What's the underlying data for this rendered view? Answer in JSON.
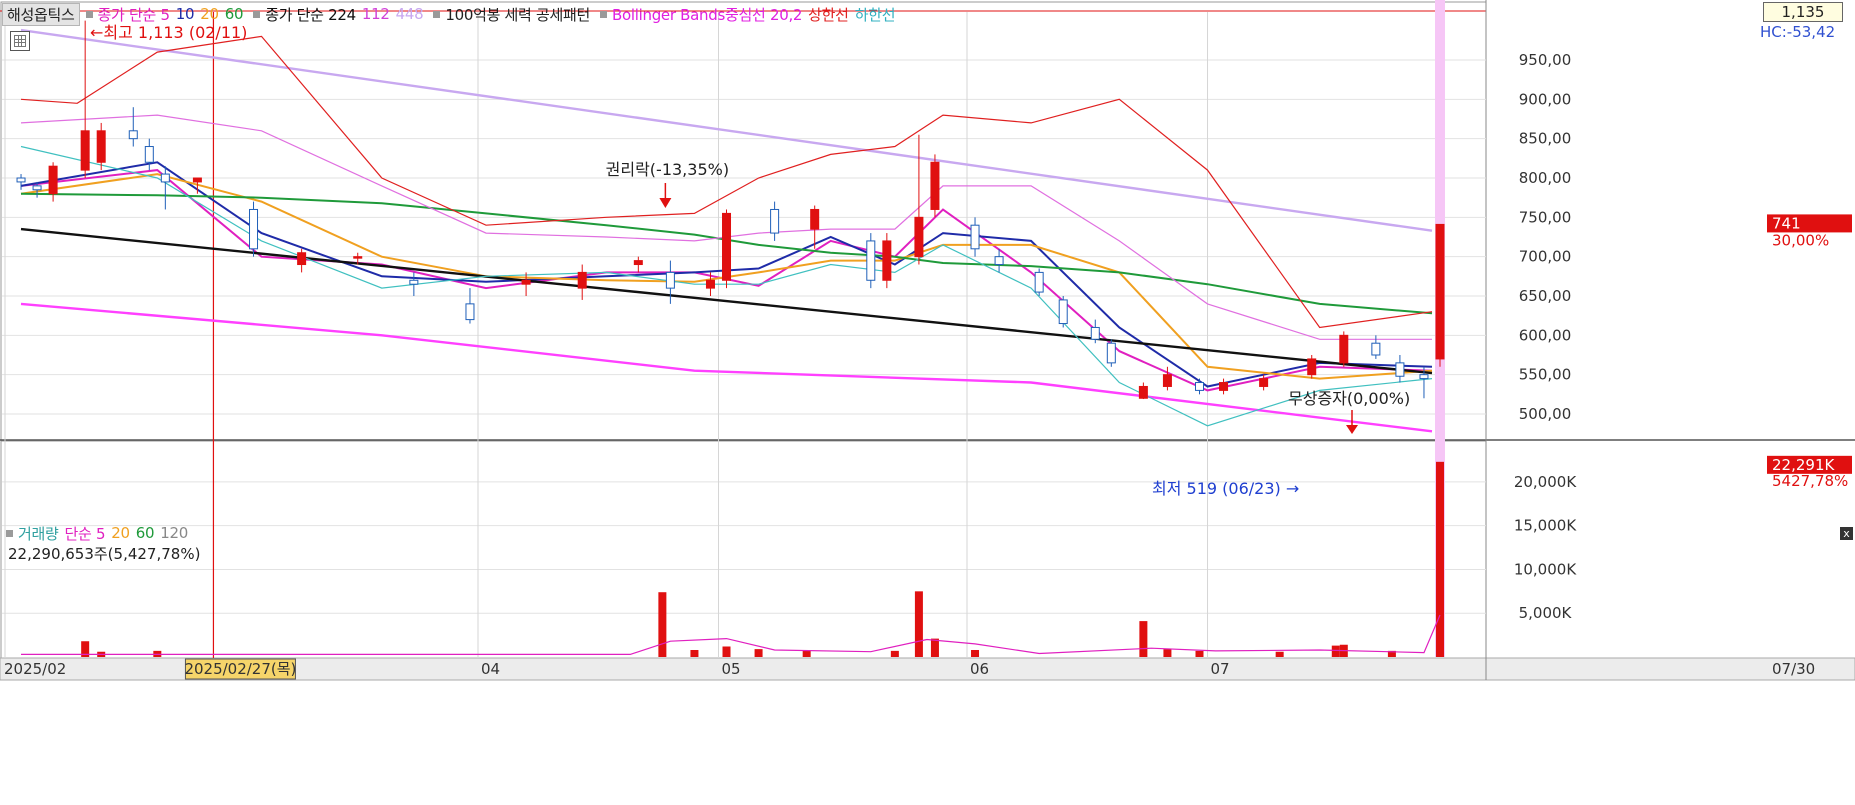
{
  "legend": {
    "stock_name": "해성옵틱스",
    "price_ma_label": "종가 단순 5",
    "price_ma_periods": [
      {
        "text": "10",
        "color": "#1f2ba8"
      },
      {
        "text": "20",
        "color": "#f0a020"
      },
      {
        "text": "60",
        "color": "#1f9a3a"
      }
    ],
    "long_ma_label": "종가 단순 224",
    "long_ma_periods": [
      {
        "text": "112",
        "color": "#d040d8"
      },
      {
        "text": "448",
        "color": "#c8a8f0"
      }
    ],
    "filter_label": "100억봉 세력 공세패턴",
    "bollinger_label": "Bollinger Bands중심선 20,2",
    "bollinger_upper": "상한선",
    "bollinger_lower": "하한선",
    "volume_label": "거래량",
    "volume_ma_label": "단순 5",
    "volume_ma_periods": [
      {
        "text": "20",
        "color": "#f0a020"
      },
      {
        "text": "60",
        "color": "#1f9a3a"
      },
      {
        "text": "120",
        "color": "#888888"
      }
    ]
  },
  "toolbar": {
    "close_value": "1,135",
    "hc_label": "HC:-53,42",
    "panel_close": "x"
  },
  "colors": {
    "up": "#e01010",
    "down": "#1f5fb8",
    "ma5": "#e020c0",
    "ma10": "#1f2ba8",
    "ma20": "#f0a020",
    "ma60": "#1f9a3a",
    "ma224": "#111111",
    "ma448": "#c8a8f0",
    "ma112": "#ff40ff",
    "bb_center": "#e070e0",
    "bb_upper": "#e02020",
    "bb_lower": "#40c0c0",
    "pink_band": "#f6c6f6",
    "price_badge": "#e01010"
  },
  "chart_data": [
    {
      "type": "candlestick",
      "name": "price",
      "y_unit": "KRW",
      "ylim": [
        460,
        1000
      ],
      "y_ticks": [
        500,
        550,
        600,
        650,
        700,
        750,
        800,
        850,
        900,
        950
      ],
      "y_tick_labels": [
        "500,00",
        "550,00",
        "600,00",
        "650,00",
        "700,00",
        "750,00",
        "800,00",
        "850,00",
        "900,00",
        "950,00"
      ],
      "x_range": [
        "2025-02-01",
        "2025-07-30"
      ],
      "x_tick_labels": [
        {
          "date": "2025-02-01",
          "text": "2025/02"
        },
        {
          "date": "2025-04-01",
          "text": "04"
        },
        {
          "date": "2025-05-01",
          "text": "05"
        },
        {
          "date": "2025-06-01",
          "text": "06"
        },
        {
          "date": "2025-07-01",
          "text": "07"
        },
        {
          "date": "2025-07-30",
          "text": "07/30"
        }
      ],
      "cursor_date": "2025-02-27",
      "cursor_label": "2025/02/27(목)",
      "annotations": [
        {
          "text": "최고 1,113 (02/11)",
          "date": "2025-02-11",
          "value": 1113
        },
        {
          "text": "권리락(-13,35%)",
          "date": "2025-04-24",
          "value": 795
        },
        {
          "text": "최저 519 (06/23)",
          "date": "2025-06-23",
          "value": 519
        },
        {
          "text": "무상증자(0,00%)",
          "date": "2025-06-27",
          "value": 585
        }
      ],
      "last_price": "741",
      "last_change": "30,00%",
      "series": [
        {
          "name": "종가 단순 5",
          "color_key": "ma5",
          "dates": [
            "2025-02-03",
            "2025-02-20",
            "2025-03-05",
            "2025-03-20",
            "2025-04-02",
            "2025-04-17",
            "2025-04-28",
            "2025-05-06",
            "2025-05-15",
            "2025-05-23",
            "2025-05-29",
            "2025-06-09",
            "2025-06-20",
            "2025-07-01",
            "2025-07-15",
            "2025-07-29"
          ],
          "values": [
            790,
            810,
            700,
            690,
            660,
            680,
            680,
            663,
            720,
            700,
            760,
            680,
            580,
            530,
            560,
            555
          ]
        },
        {
          "name": "종가 단순 10",
          "color_key": "ma10",
          "dates": [
            "2025-02-03",
            "2025-02-20",
            "2025-03-05",
            "2025-03-20",
            "2025-04-02",
            "2025-04-17",
            "2025-04-28",
            "2025-05-06",
            "2025-05-15",
            "2025-05-23",
            "2025-05-29",
            "2025-06-09",
            "2025-06-20",
            "2025-07-01",
            "2025-07-15",
            "2025-07-29"
          ],
          "values": [
            790,
            820,
            730,
            675,
            668,
            675,
            680,
            685,
            725,
            690,
            730,
            720,
            610,
            535,
            565,
            560
          ]
        },
        {
          "name": "종가 단순 20",
          "color_key": "ma20",
          "dates": [
            "2025-02-03",
            "2025-02-20",
            "2025-03-05",
            "2025-03-20",
            "2025-04-02",
            "2025-04-17",
            "2025-04-28",
            "2025-05-06",
            "2025-05-15",
            "2025-05-23",
            "2025-05-29",
            "2025-06-09",
            "2025-06-20",
            "2025-07-01",
            "2025-07-15",
            "2025-07-29"
          ],
          "values": [
            780,
            805,
            770,
            700,
            675,
            670,
            668,
            680,
            695,
            695,
            715,
            715,
            680,
            560,
            545,
            555
          ]
        },
        {
          "name": "종가 단순 60",
          "color_key": "ma60",
          "dates": [
            "2025-02-03",
            "2025-02-20",
            "2025-03-05",
            "2025-03-20",
            "2025-04-02",
            "2025-04-17",
            "2025-04-28",
            "2025-05-06",
            "2025-05-15",
            "2025-05-23",
            "2025-05-29",
            "2025-06-09",
            "2025-06-20",
            "2025-07-01",
            "2025-07-15",
            "2025-07-29"
          ],
          "values": [
            780,
            778,
            775,
            768,
            755,
            740,
            728,
            715,
            705,
            700,
            692,
            688,
            680,
            665,
            640,
            628
          ]
        },
        {
          "name": "종가 단순 224",
          "color_key": "ma224",
          "dates": [
            "2025-02-03",
            "2025-07-29"
          ],
          "values": [
            735,
            552
          ]
        },
        {
          "name": "종가 단순 448",
          "color_key": "ma448",
          "dates": [
            "2025-02-03",
            "2025-07-29"
          ],
          "values": [
            988,
            733
          ]
        },
        {
          "name": "종가 단순 112",
          "color_key": "ma112",
          "dates": [
            "2025-02-03",
            "2025-03-20",
            "2025-04-28",
            "2025-06-09",
            "2025-07-29"
          ],
          "values": [
            640,
            600,
            555,
            540,
            478
          ]
        },
        {
          "name": "Bollinger Bands중심선 20,2",
          "color_key": "bb_center",
          "dates": [
            "2025-02-03",
            "2025-02-20",
            "2025-03-05",
            "2025-03-20",
            "2025-04-02",
            "2025-04-17",
            "2025-04-28",
            "2025-05-06",
            "2025-05-15",
            "2025-05-23",
            "2025-05-29",
            "2025-06-09",
            "2025-06-20",
            "2025-07-01",
            "2025-07-15",
            "2025-07-29"
          ],
          "values": [
            870,
            880,
            860,
            790,
            730,
            725,
            720,
            730,
            735,
            735,
            790,
            790,
            720,
            640,
            595,
            595
          ]
        },
        {
          "name": "상한선",
          "color_key": "bb_upper",
          "dates": [
            "2025-02-03",
            "2025-02-10",
            "2025-02-20",
            "2025-03-05",
            "2025-03-20",
            "2025-04-02",
            "2025-04-17",
            "2025-04-28",
            "2025-05-06",
            "2025-05-15",
            "2025-05-23",
            "2025-05-29",
            "2025-06-09",
            "2025-06-20",
            "2025-07-01",
            "2025-07-15",
            "2025-07-29"
          ],
          "values": [
            900,
            895,
            960,
            980,
            800,
            740,
            750,
            755,
            800,
            830,
            840,
            880,
            870,
            900,
            810,
            610,
            630
          ]
        },
        {
          "name": "하한선",
          "color_key": "bb_lower",
          "dates": [
            "2025-02-03",
            "2025-02-20",
            "2025-03-05",
            "2025-03-20",
            "2025-04-02",
            "2025-04-17",
            "2025-04-28",
            "2025-05-06",
            "2025-05-15",
            "2025-05-23",
            "2025-05-29",
            "2025-06-09",
            "2025-06-20",
            "2025-07-01",
            "2025-07-15",
            "2025-07-29"
          ],
          "values": [
            840,
            800,
            720,
            660,
            675,
            680,
            665,
            665,
            690,
            680,
            715,
            660,
            540,
            485,
            530,
            545
          ]
        }
      ],
      "candles": [
        {
          "date": "2025-02-03",
          "o": 800,
          "h": 805,
          "l": 785,
          "c": 795
        },
        {
          "date": "2025-02-05",
          "o": 790,
          "h": 795,
          "l": 775,
          "c": 785
        },
        {
          "date": "2025-02-07",
          "o": 780,
          "h": 820,
          "l": 770,
          "c": 815
        },
        {
          "date": "2025-02-11",
          "o": 810,
          "h": 1113,
          "l": 800,
          "c": 860
        },
        {
          "date": "2025-02-13",
          "o": 820,
          "h": 870,
          "l": 810,
          "c": 860
        },
        {
          "date": "2025-02-17",
          "o": 860,
          "h": 890,
          "l": 840,
          "c": 850
        },
        {
          "date": "2025-02-19",
          "o": 840,
          "h": 850,
          "l": 810,
          "c": 820
        },
        {
          "date": "2025-02-21",
          "o": 805,
          "h": 815,
          "l": 760,
          "c": 795
        },
        {
          "date": "2025-02-25",
          "o": 795,
          "h": 800,
          "l": 780,
          "c": 800
        },
        {
          "date": "2025-03-04",
          "o": 760,
          "h": 770,
          "l": 700,
          "c": 710
        },
        {
          "date": "2025-03-10",
          "o": 690,
          "h": 710,
          "l": 680,
          "c": 705
        },
        {
          "date": "2025-03-17",
          "o": 700,
          "h": 705,
          "l": 690,
          "c": 700
        },
        {
          "date": "2025-03-24",
          "o": 670,
          "h": 680,
          "l": 650,
          "c": 665
        },
        {
          "date": "2025-03-31",
          "o": 640,
          "h": 660,
          "l": 615,
          "c": 620
        },
        {
          "date": "2025-04-07",
          "o": 665,
          "h": 680,
          "l": 650,
          "c": 670
        },
        {
          "date": "2025-04-14",
          "o": 660,
          "h": 690,
          "l": 645,
          "c": 680
        },
        {
          "date": "2025-04-21",
          "o": 690,
          "h": 700,
          "l": 680,
          "c": 695
        },
        {
          "date": "2025-04-25",
          "o": 680,
          "h": 695,
          "l": 640,
          "c": 660
        },
        {
          "date": "2025-04-30",
          "o": 660,
          "h": 680,
          "l": 650,
          "c": 670
        },
        {
          "date": "2025-05-02",
          "o": 670,
          "h": 760,
          "l": 660,
          "c": 755
        },
        {
          "date": "2025-05-08",
          "o": 760,
          "h": 770,
          "l": 720,
          "c": 730
        },
        {
          "date": "2025-05-13",
          "o": 735,
          "h": 765,
          "l": 710,
          "c": 760
        },
        {
          "date": "2025-05-20",
          "o": 720,
          "h": 730,
          "l": 660,
          "c": 670
        },
        {
          "date": "2025-05-22",
          "o": 670,
          "h": 730,
          "l": 660,
          "c": 720
        },
        {
          "date": "2025-05-26",
          "o": 700,
          "h": 855,
          "l": 690,
          "c": 750
        },
        {
          "date": "2025-05-28",
          "o": 760,
          "h": 830,
          "l": 750,
          "c": 820
        },
        {
          "date": "2025-06-02",
          "o": 740,
          "h": 750,
          "l": 700,
          "c": 710
        },
        {
          "date": "2025-06-05",
          "o": 700,
          "h": 710,
          "l": 680,
          "c": 690
        },
        {
          "date": "2025-06-10",
          "o": 680,
          "h": 685,
          "l": 650,
          "c": 655
        },
        {
          "date": "2025-06-13",
          "o": 645,
          "h": 650,
          "l": 610,
          "c": 615
        },
        {
          "date": "2025-06-17",
          "o": 610,
          "h": 620,
          "l": 590,
          "c": 595
        },
        {
          "date": "2025-06-19",
          "o": 590,
          "h": 595,
          "l": 560,
          "c": 565
        },
        {
          "date": "2025-06-23",
          "o": 520,
          "h": 540,
          "l": 519,
          "c": 535
        },
        {
          "date": "2025-06-26",
          "o": 535,
          "h": 560,
          "l": 530,
          "c": 550
        },
        {
          "date": "2025-06-30",
          "o": 540,
          "h": 545,
          "l": 525,
          "c": 530
        },
        {
          "date": "2025-07-03",
          "o": 530,
          "h": 545,
          "l": 525,
          "c": 540
        },
        {
          "date": "2025-07-08",
          "o": 535,
          "h": 550,
          "l": 530,
          "c": 545
        },
        {
          "date": "2025-07-14",
          "o": 550,
          "h": 575,
          "l": 545,
          "c": 570
        },
        {
          "date": "2025-07-18",
          "o": 565,
          "h": 605,
          "l": 560,
          "c": 600
        },
        {
          "date": "2025-07-22",
          "o": 590,
          "h": 600,
          "l": 570,
          "c": 575
        },
        {
          "date": "2025-07-25",
          "o": 565,
          "h": 575,
          "l": 540,
          "c": 548
        },
        {
          "date": "2025-07-28",
          "o": 550,
          "h": 560,
          "l": 520,
          "c": 545
        },
        {
          "date": "2025-07-30",
          "o": 570,
          "h": 741,
          "l": 560,
          "c": 741
        }
      ]
    },
    {
      "type": "bar",
      "name": "volume",
      "y_unit": "K shares",
      "ylim": [
        0,
        22500
      ],
      "y_ticks": [
        5000,
        10000,
        15000,
        20000
      ],
      "y_tick_labels": [
        "5,000K",
        "10,000K",
        "15,000K",
        "20,000K"
      ],
      "x_range": [
        "2025-02-01",
        "2025-07-30"
      ],
      "current_volume": "22,290,653주(5,427,78%)",
      "last_volume": "22,291K",
      "last_volume_change": "5427,78%",
      "series": [
        {
          "name": "거래량",
          "dates": [
            "2025-02-11",
            "2025-02-13",
            "2025-02-20",
            "2025-04-24",
            "2025-04-28",
            "2025-05-02",
            "2025-05-06",
            "2025-05-12",
            "2025-05-23",
            "2025-05-26",
            "2025-05-28",
            "2025-06-02",
            "2025-06-23",
            "2025-06-26",
            "2025-06-30",
            "2025-07-10",
            "2025-07-17",
            "2025-07-18",
            "2025-07-24",
            "2025-07-30"
          ],
          "values": [
            1800,
            600,
            700,
            7400,
            800,
            1200,
            900,
            700,
            700,
            7500,
            2100,
            800,
            4100,
            900,
            700,
            600,
            1300,
            1400,
            700,
            22291
          ]
        },
        {
          "name": "단순 5",
          "dates": [
            "2025-02-03",
            "2025-04-20",
            "2025-04-25",
            "2025-05-02",
            "2025-05-08",
            "2025-05-20",
            "2025-05-27",
            "2025-06-02",
            "2025-06-10",
            "2025-06-24",
            "2025-07-02",
            "2025-07-15",
            "2025-07-28",
            "2025-07-30"
          ],
          "values": [
            300,
            300,
            1800,
            2100,
            800,
            600,
            2000,
            1500,
            400,
            1000,
            700,
            800,
            500,
            4800
          ]
        }
      ]
    }
  ]
}
